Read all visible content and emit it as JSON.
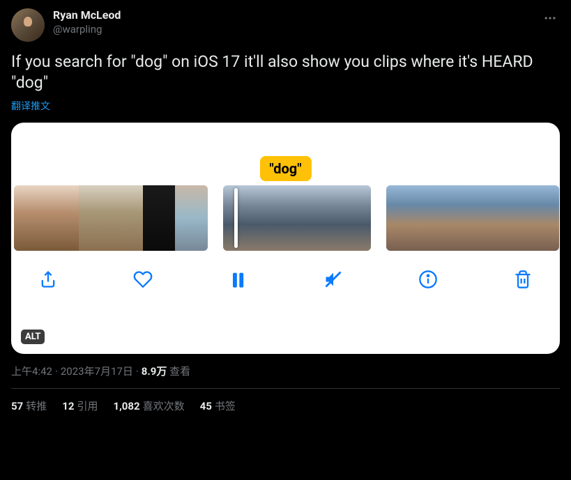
{
  "user": {
    "display_name": "Ryan McLeod",
    "handle": "@warpling"
  },
  "tweet_text": "If you search for \"dog\" on iOS 17 it'll also show you clips where it's HEARD \"dog\"",
  "translate_label": "翻译推文",
  "media": {
    "tag_text": "\"dog\"",
    "alt_badge": "ALT",
    "toolbar": {
      "share": "share",
      "like": "like",
      "pause": "pause",
      "mute": "mute",
      "info": "info",
      "delete": "delete"
    }
  },
  "meta": {
    "time": "上午4:42",
    "date": "2023年7月17日",
    "views_count": "8.9万",
    "views_label": "查看"
  },
  "stats": {
    "retweets_count": "57",
    "retweets_label": "转推",
    "quotes_count": "12",
    "quotes_label": "引用",
    "likes_count": "1,082",
    "likes_label": "喜欢次数",
    "bookmarks_count": "45",
    "bookmarks_label": "书签"
  }
}
